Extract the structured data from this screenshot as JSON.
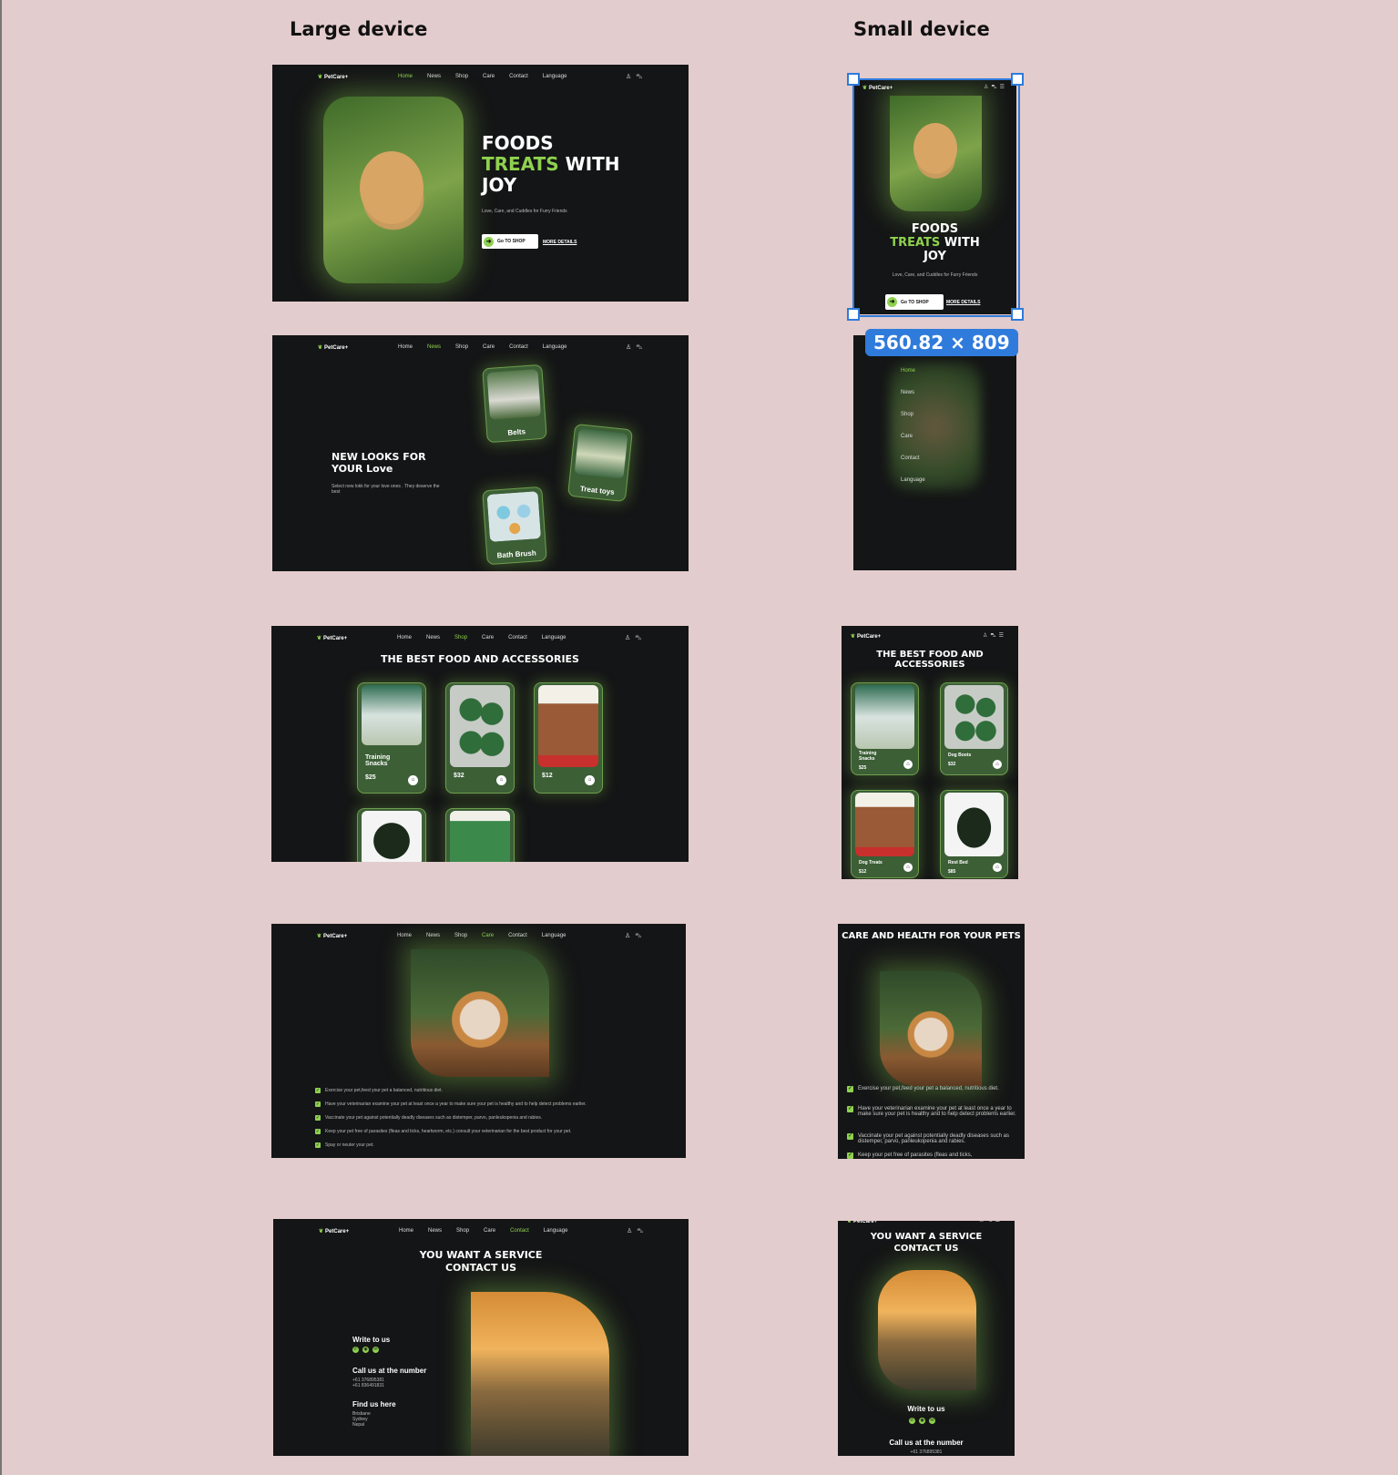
{
  "headings": {
    "large": "Large device",
    "small": "Small device"
  },
  "brand": "PetCare+",
  "nav": [
    "Home",
    "News",
    "Shop",
    "Care",
    "Contact",
    "Language"
  ],
  "hero": {
    "line1": "FOODS",
    "green": "TREATS",
    "line2_rest": " WITH",
    "line3": "JOY",
    "subtitle": "Love, Care, and Cuddles for Furry Friends",
    "shop_button": "Go TO SHOP",
    "more": "MORE DETAILS"
  },
  "looks": {
    "title": "NEW LOOKS FOR YOUR Love",
    "subtitle": "Select new lokk for your love ones . They deserve the best",
    "tiles": [
      "Belts",
      "Treat toys",
      "Bath Brush"
    ]
  },
  "shop": {
    "title": "THE BEST FOOD AND ACCESSORIES",
    "large_cards": [
      {
        "name": "Training Snacks",
        "price": "$25"
      },
      {
        "name": "",
        "price": "$32"
      },
      {
        "name": "",
        "price": "$12"
      }
    ],
    "small_cards": [
      {
        "name": "Training Snacks",
        "price": "$25"
      },
      {
        "name": "Dog Boots",
        "price": "$32"
      },
      {
        "name": "Dog Treats",
        "price": "$12"
      },
      {
        "name": "Rest Bed",
        "price": "$85"
      }
    ]
  },
  "care": {
    "title": "CARE AND HEALTH FOR YOUR PETS",
    "items": [
      "Exercise your pet,feed your pet a balanced, nutritious diet.",
      "Have your veterinarian examine your pet at least once a year to make sure your pet is healthy and to help detect problems earlier.",
      "Vaccinate your pet against potentially deadly diseases such as distemper, parvo, panleukopenia and rabies.",
      "Keep your pet free of parasites (fleas and ticks, heartworm, etc.) consult your veterinarian for the best product for your pet.",
      "Spay or neuter your pet."
    ],
    "mobile_items": [
      "Exercise your pet,feed your pet a balanced, nutritious diet.",
      "Have your veterinarian examine your pet at least once a year to make sure your pet is healthy and to help detect problems earlier.",
      "Vaccinate your pet against potentially deadly diseases such as distemper, parvo, panleukopenia and rabies.",
      "Keep your pet free of parasites (fleas and ticks,"
    ]
  },
  "contact": {
    "title_l1": "YOU WANT A SERVICE",
    "title_l2": "CONTACT US",
    "write": "Write to us",
    "call": "Call us at the number",
    "phone1": "+61 376895381",
    "phone2": "+61 836491831",
    "find": "Find us here",
    "places": [
      "Brisbane",
      "Sydney",
      "Nepal"
    ]
  },
  "selection": {
    "dimensions": "560.82 × 809"
  },
  "colors": {
    "accent": "#8fd14f",
    "frame_bg": "#141516",
    "canvas_bg": "#e3cccd",
    "selection": "#2f7bdc"
  }
}
